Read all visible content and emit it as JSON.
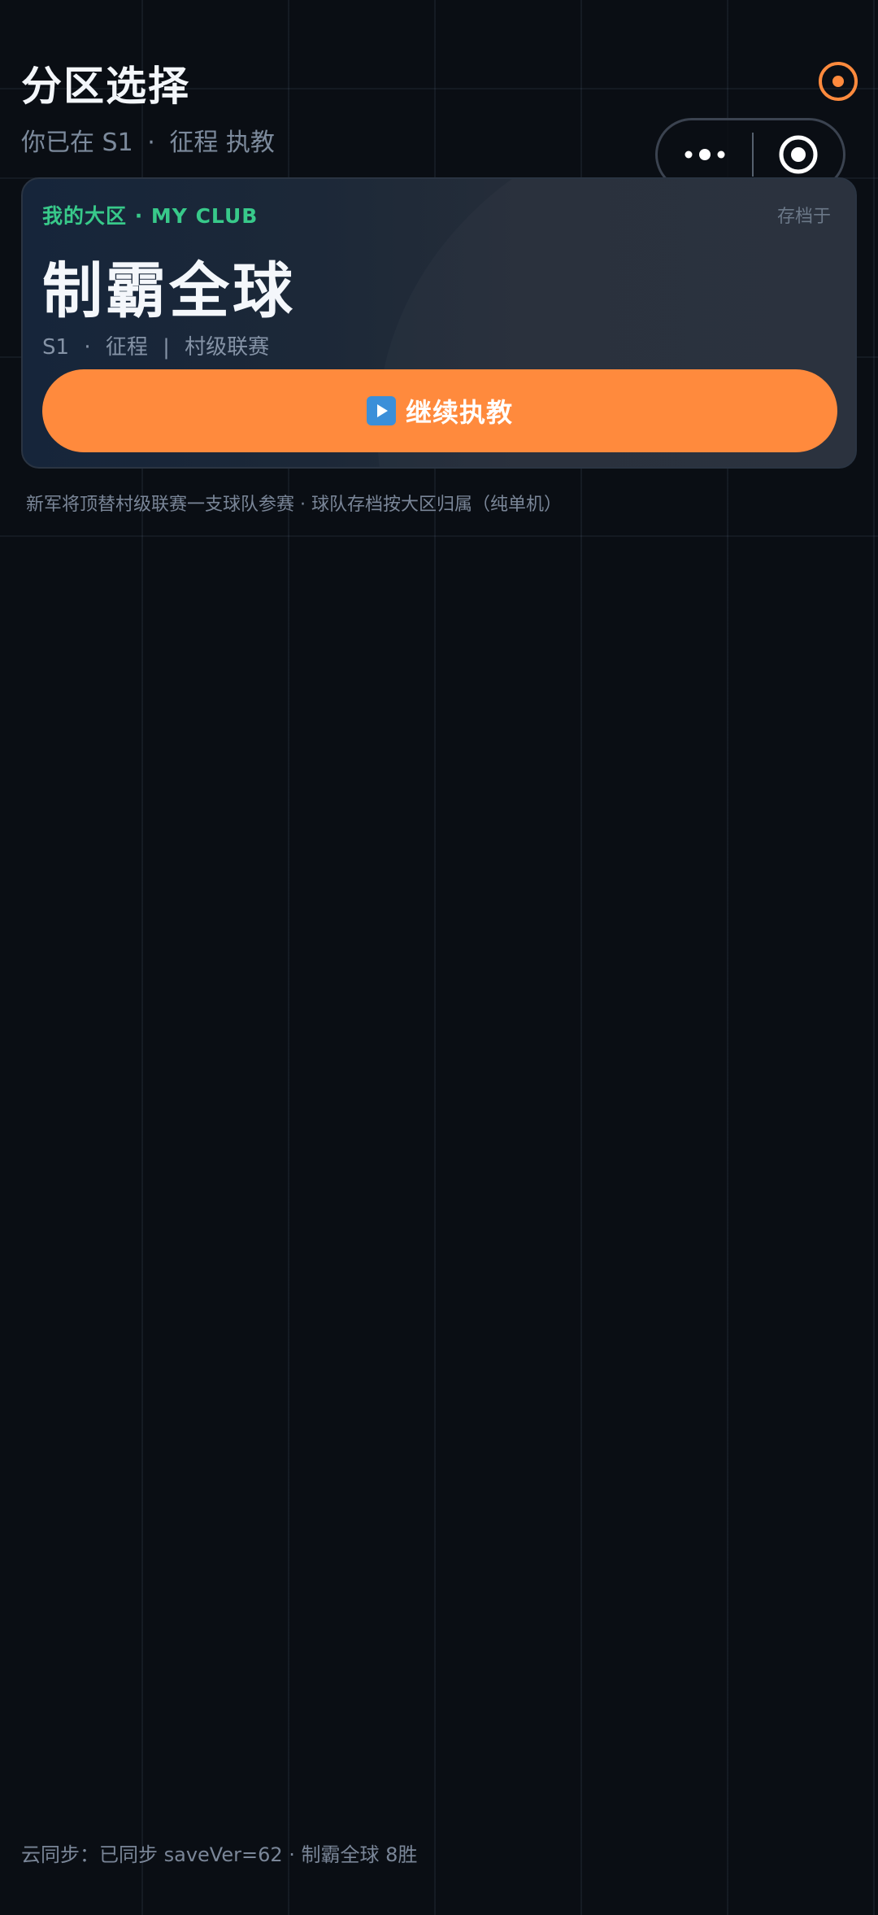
{
  "header": {
    "title": "分区选择",
    "subtitle_prefix": "你已在",
    "subtitle_season": "S1",
    "subtitle_dot": "·",
    "subtitle_mode": "征程 执教"
  },
  "icons": {
    "settings": "settings-ring-icon",
    "capsule_more": "more-dots-icon",
    "capsule_close": "target-close-icon",
    "play": "play-icon"
  },
  "club_card": {
    "label": "我的大区 · MY CLUB",
    "saved_in": "存档于",
    "name": "制霸全球",
    "meta_season": "S1",
    "meta_dot": "·",
    "meta_mode": "征程",
    "meta_sep": "|",
    "meta_league": "村级联赛",
    "continue_label": "继续执教"
  },
  "note": "新军将顶替村级联赛一支球队参赛 · 球队存档按大区归属（纯单机）",
  "footer": {
    "sync_status": "云同步：已同步 saveVer=62 · 制霸全球 8胜"
  },
  "colors": {
    "background": "#0a0e14",
    "accent": "#ff8a3d",
    "club_label": "#38c98a",
    "muted_text": "#7a8698"
  }
}
